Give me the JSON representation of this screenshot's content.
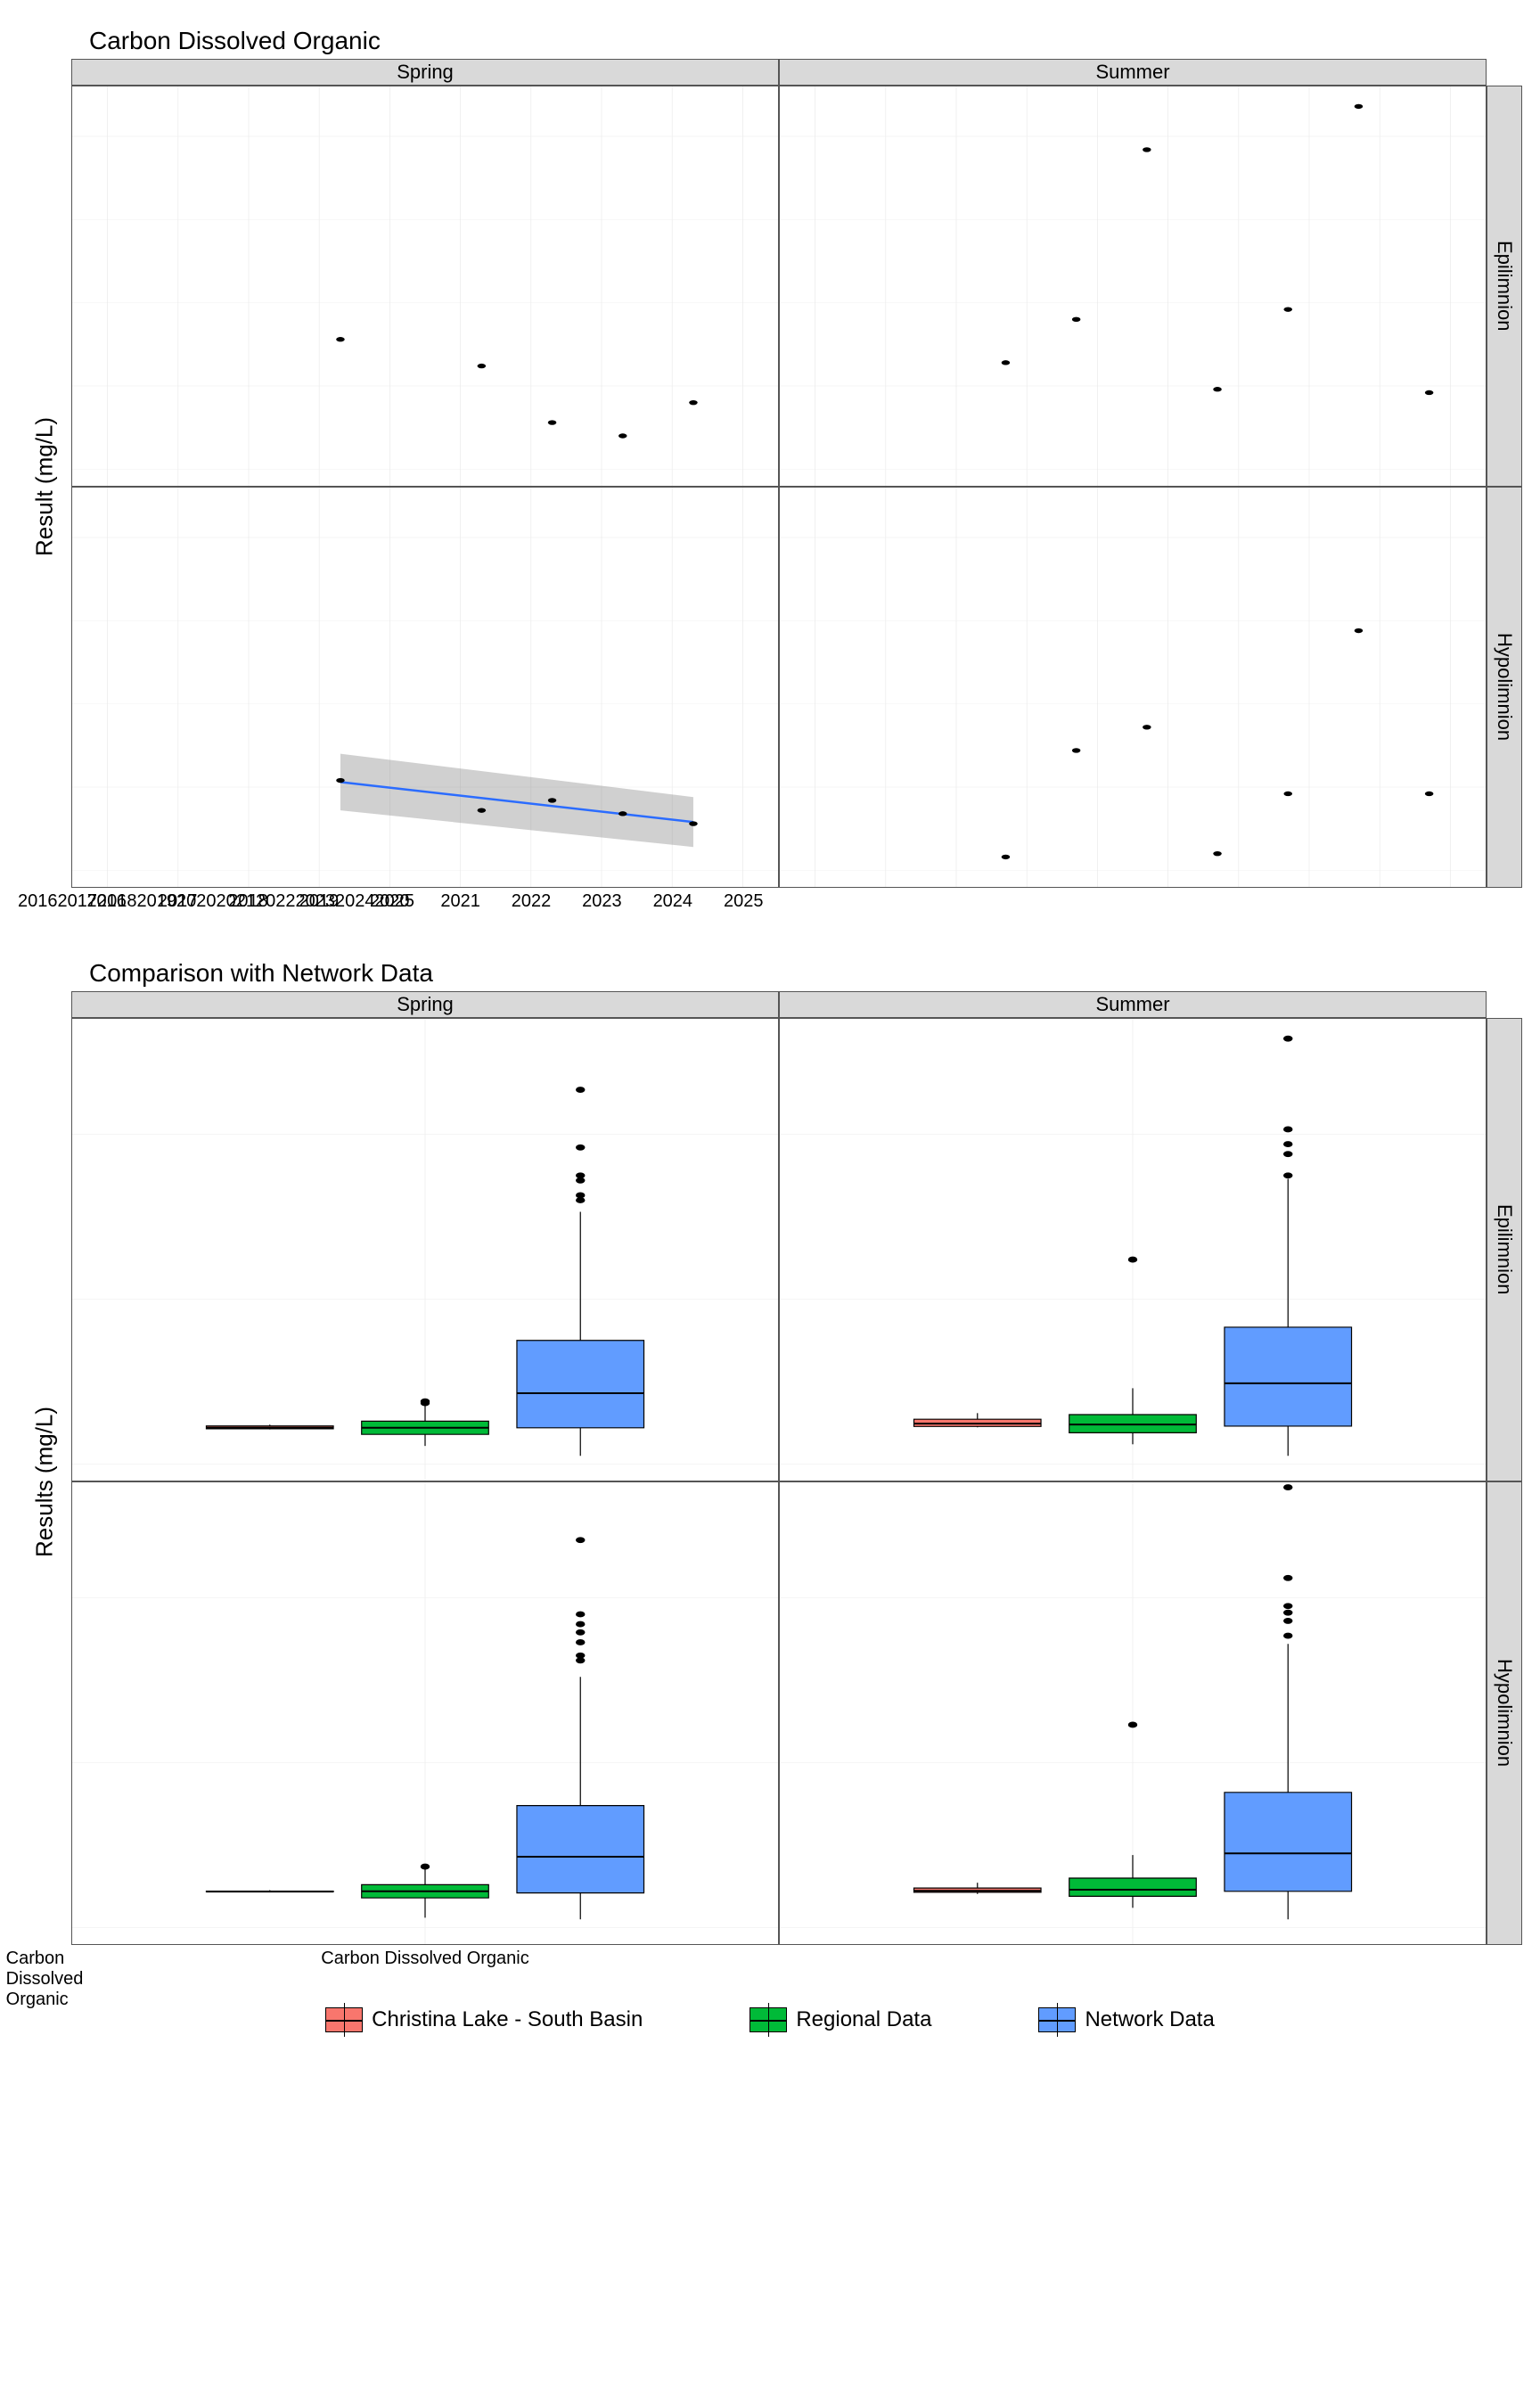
{
  "chart_data": [
    {
      "type": "scatter",
      "title": "Carbon Dissolved Organic",
      "ylabel": "Result (mg/L)",
      "xlabel": "",
      "x_ticks": [
        "2016",
        "2017",
        "2018",
        "2019",
        "2020",
        "2021",
        "2022",
        "2023",
        "2024",
        "2025"
      ],
      "y_ticks": [
        2.0,
        2.25,
        2.5,
        2.75,
        3.0
      ],
      "ylim": [
        1.95,
        3.15
      ],
      "xlim": [
        2015.5,
        2025.5
      ],
      "facets_col": [
        "Spring",
        "Summer"
      ],
      "facets_row": [
        "Epilimnion",
        "Hypolimnion"
      ],
      "panels": {
        "Spring|Epilimnion": {
          "points": [
            {
              "x": 2019.3,
              "y": 2.39
            },
            {
              "x": 2021.3,
              "y": 2.31
            },
            {
              "x": 2022.3,
              "y": 2.14
            },
            {
              "x": 2023.3,
              "y": 2.1
            },
            {
              "x": 2024.3,
              "y": 2.2
            }
          ]
        },
        "Summer|Epilimnion": {
          "points": [
            {
              "x": 2018.7,
              "y": 2.32
            },
            {
              "x": 2019.7,
              "y": 2.45
            },
            {
              "x": 2020.7,
              "y": 2.96
            },
            {
              "x": 2021.7,
              "y": 2.24
            },
            {
              "x": 2022.7,
              "y": 2.48
            },
            {
              "x": 2023.7,
              "y": 3.09
            },
            {
              "x": 2024.7,
              "y": 2.23
            }
          ]
        },
        "Spring|Hypolimnion": {
          "points": [
            {
              "x": 2019.3,
              "y": 2.27
            },
            {
              "x": 2021.3,
              "y": 2.18
            },
            {
              "x": 2022.3,
              "y": 2.21
            },
            {
              "x": 2023.3,
              "y": 2.17
            },
            {
              "x": 2024.3,
              "y": 2.14
            }
          ],
          "trend": {
            "x0": 2019.3,
            "y0": 2.265,
            "x1": 2024.3,
            "y1": 2.145
          },
          "ribbon": [
            {
              "x": 2019.3,
              "lo": 2.18,
              "hi": 2.35
            },
            {
              "x": 2024.3,
              "lo": 2.07,
              "hi": 2.22
            }
          ]
        },
        "Summer|Hypolimnion": {
          "points": [
            {
              "x": 2018.7,
              "y": 2.04
            },
            {
              "x": 2019.7,
              "y": 2.36
            },
            {
              "x": 2020.7,
              "y": 2.43
            },
            {
              "x": 2021.7,
              "y": 2.05
            },
            {
              "x": 2022.7,
              "y": 2.23
            },
            {
              "x": 2023.7,
              "y": 2.72
            },
            {
              "x": 2024.7,
              "y": 2.23
            }
          ]
        }
      }
    },
    {
      "type": "box",
      "title": "Comparison with Network Data",
      "ylabel": "Results (mg/L)",
      "xlabel": "",
      "categories": [
        "Carbon Dissolved Organic"
      ],
      "y_ticks": [
        0,
        10,
        20
      ],
      "ylim": [
        -1,
        27
      ],
      "facets_col": [
        "Spring",
        "Summer"
      ],
      "facets_row": [
        "Epilimnion",
        "Hypolimnion"
      ],
      "series": [
        {
          "name": "Christina Lake - South Basin",
          "color": "#f8766d"
        },
        {
          "name": "Regional Data",
          "color": "#00ba38"
        },
        {
          "name": "Network Data",
          "color": "#619cff"
        }
      ],
      "panels": {
        "Spring|Epilimnion": [
          {
            "series": 0,
            "min": 2.1,
            "q1": 2.14,
            "med": 2.2,
            "q3": 2.31,
            "max": 2.39,
            "out": []
          },
          {
            "series": 1,
            "min": 1.1,
            "q1": 1.8,
            "med": 2.2,
            "q3": 2.6,
            "max": 3.6,
            "out": [
              3.7,
              3.8
            ]
          },
          {
            "series": 2,
            "min": 0.5,
            "q1": 2.2,
            "med": 4.3,
            "q3": 7.5,
            "max": 15.3,
            "out": [
              16.0,
              16.3,
              17.2,
              17.5,
              19.2,
              22.7
            ]
          }
        ],
        "Summer|Epilimnion": [
          {
            "series": 0,
            "min": 2.23,
            "q1": 2.28,
            "med": 2.45,
            "q3": 2.72,
            "max": 3.09,
            "out": []
          },
          {
            "series": 1,
            "min": 1.2,
            "q1": 1.9,
            "med": 2.4,
            "q3": 3.0,
            "max": 4.6,
            "out": [
              12.4
            ]
          },
          {
            "series": 2,
            "min": 0.5,
            "q1": 2.3,
            "med": 4.9,
            "q3": 8.3,
            "max": 17.3,
            "out": [
              17.5,
              18.8,
              19.4,
              20.3,
              25.8
            ]
          }
        ],
        "Spring|Hypolimnion": [
          {
            "series": 0,
            "min": 2.14,
            "q1": 2.17,
            "med": 2.18,
            "q3": 2.21,
            "max": 2.27,
            "out": []
          },
          {
            "series": 1,
            "min": 0.6,
            "q1": 1.8,
            "med": 2.2,
            "q3": 2.6,
            "max": 3.6,
            "out": [
              3.7
            ]
          },
          {
            "series": 2,
            "min": 0.5,
            "q1": 2.1,
            "med": 4.3,
            "q3": 7.4,
            "max": 15.2,
            "out": [
              16.2,
              16.5,
              17.3,
              17.9,
              18.4,
              19.0,
              23.5
            ]
          }
        ],
        "Summer|Hypolimnion": [
          {
            "series": 0,
            "min": 2.04,
            "q1": 2.14,
            "med": 2.23,
            "q3": 2.4,
            "max": 2.72,
            "out": []
          },
          {
            "series": 1,
            "min": 1.2,
            "q1": 1.9,
            "med": 2.3,
            "q3": 3.0,
            "max": 4.4,
            "out": [
              12.3
            ]
          },
          {
            "series": 2,
            "min": 0.5,
            "q1": 2.2,
            "med": 4.5,
            "q3": 8.2,
            "max": 17.2,
            "out": [
              17.7,
              18.6,
              19.1,
              19.5,
              21.2,
              26.7
            ]
          }
        ]
      }
    }
  ],
  "legend": {
    "items": [
      {
        "label": "Christina Lake - South Basin",
        "color": "#f8766d"
      },
      {
        "label": "Regional Data",
        "color": "#00ba38"
      },
      {
        "label": "Network Data",
        "color": "#619cff"
      }
    ]
  }
}
